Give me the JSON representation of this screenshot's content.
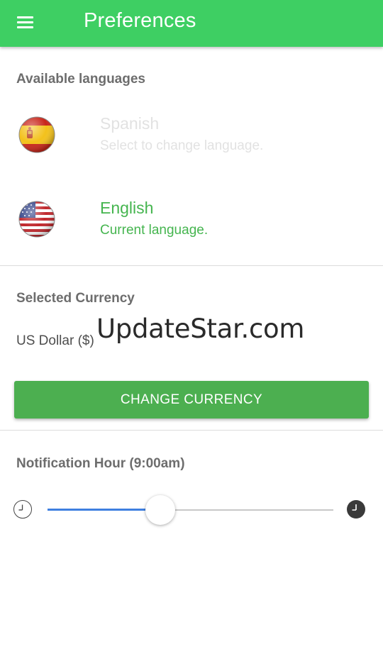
{
  "appbar": {
    "title": "Preferences",
    "menu_icon": "hamburger-menu-icon",
    "color": "#3ecf63"
  },
  "languages": {
    "header": "Available languages",
    "items": [
      {
        "name": "Spanish",
        "subtitle": "Select to change language.",
        "flag_icon": "spain-flag-icon",
        "state": "inactive"
      },
      {
        "name": "English",
        "subtitle": "Current language.",
        "flag_icon": "usa-flag-icon",
        "state": "active"
      }
    ]
  },
  "currency": {
    "header": "Selected Currency",
    "value": "US Dollar ($)",
    "button_label": "CHANGE CURRENCY",
    "button_color": "#4caf50"
  },
  "notification": {
    "header": "Notification Hour (9:00am)",
    "slider_fraction": 0.395,
    "start_icon": "clock-outline-icon",
    "end_icon": "clock-filled-icon",
    "fill_color": "#3f7fe0"
  },
  "watermark": {
    "text": "UpdateStar.com"
  }
}
